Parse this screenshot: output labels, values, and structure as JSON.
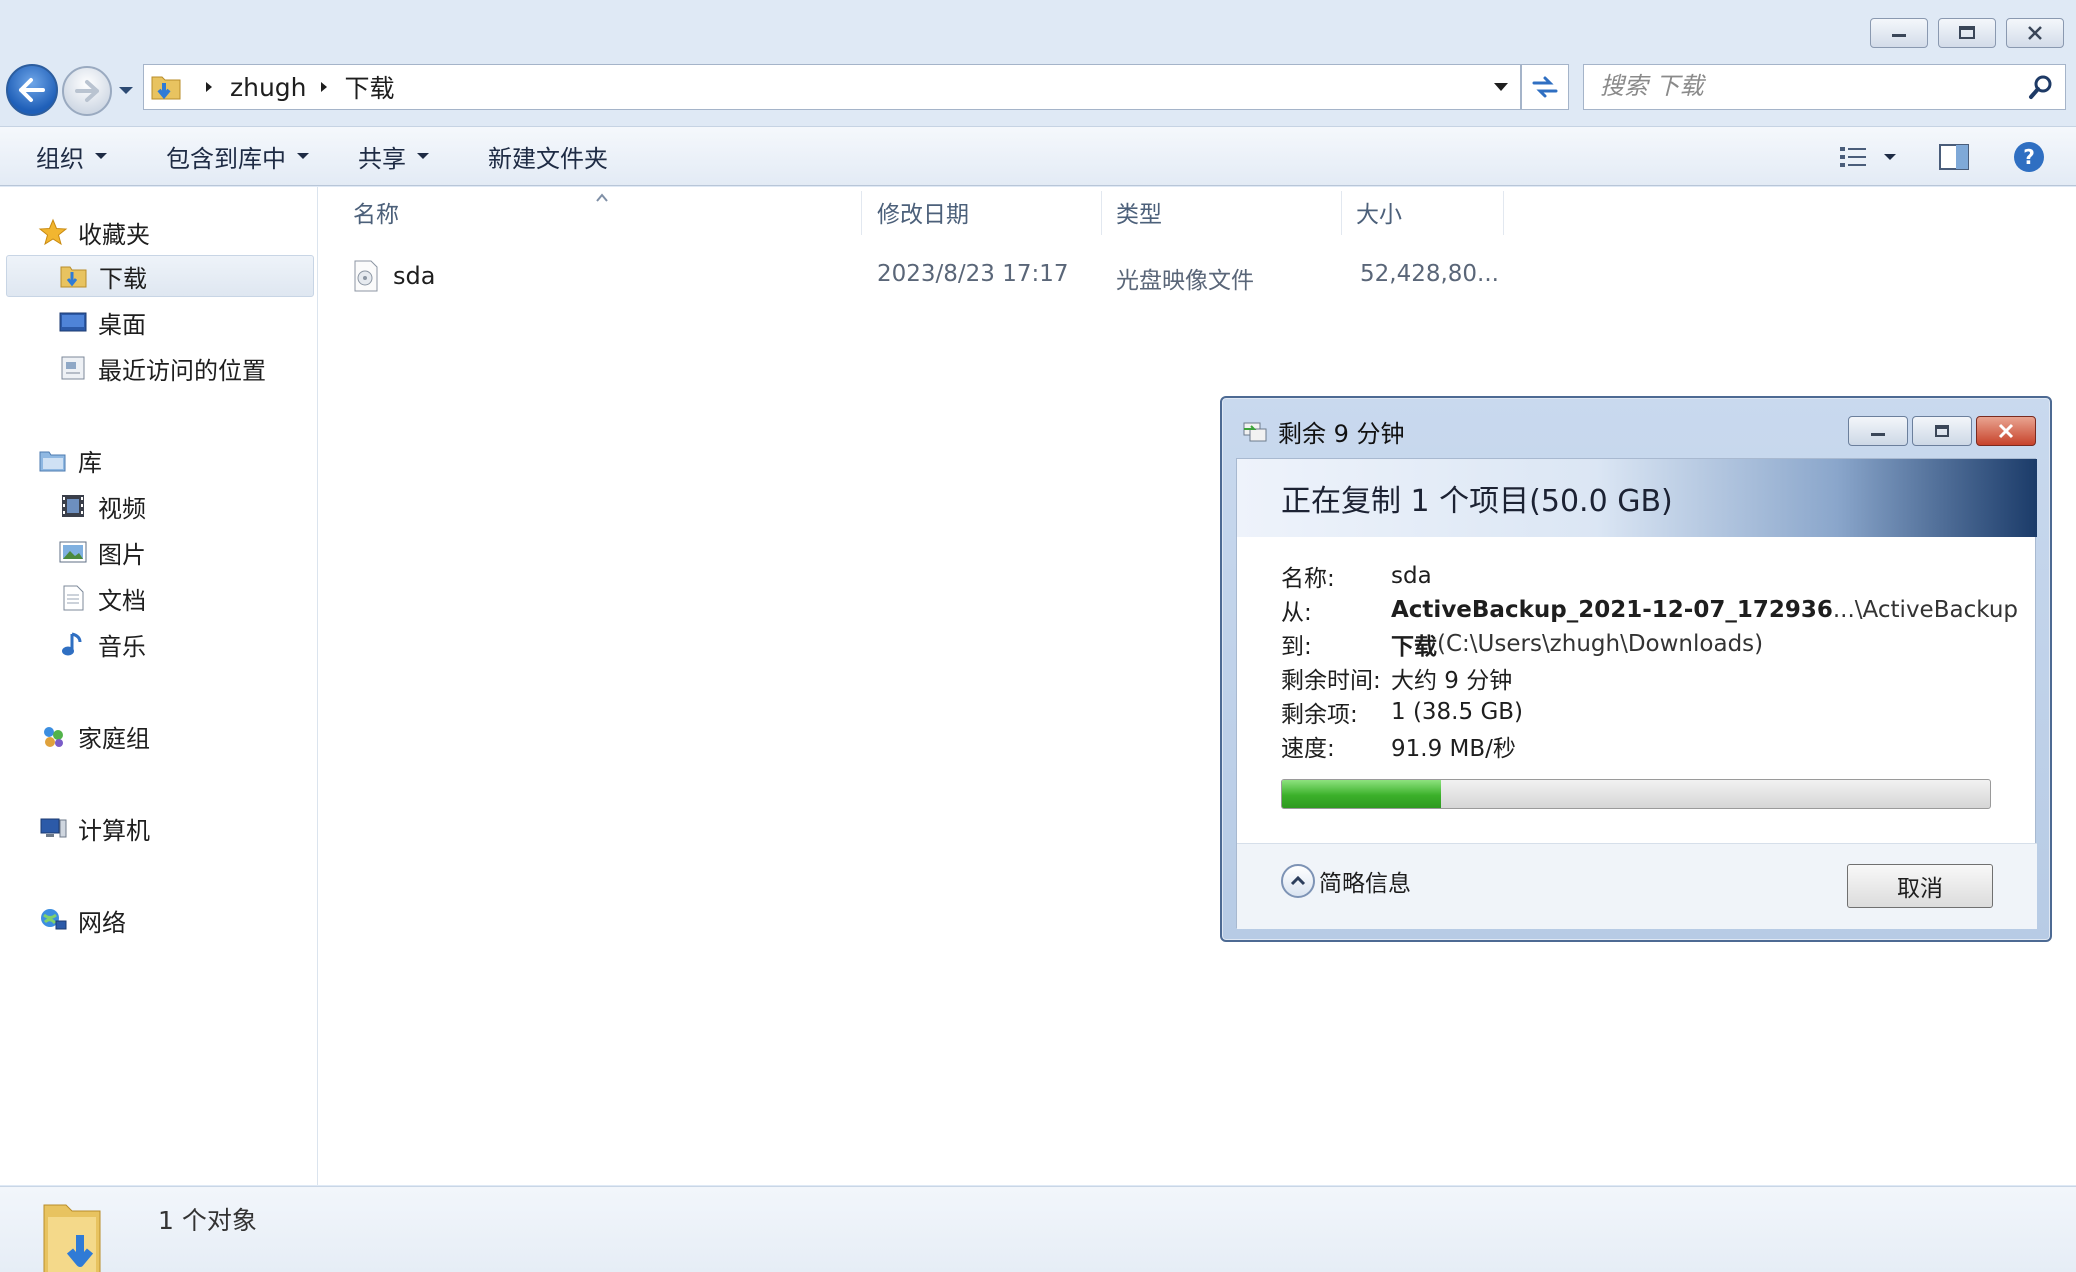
{
  "window": {
    "caption": {
      "minimize": "minimize",
      "maximize": "maximize",
      "close": "close"
    }
  },
  "address": {
    "crumbs": [
      "zhugh",
      "下载"
    ],
    "search_placeholder": "搜索 下载"
  },
  "toolbar": {
    "organize": "组织",
    "include_in_library": "包含到库中",
    "share": "共享",
    "new_folder": "新建文件夹"
  },
  "nav": {
    "favorites": "收藏夹",
    "downloads": "下载",
    "desktop": "桌面",
    "recent": "最近访问的位置",
    "libraries": "库",
    "videos": "视频",
    "pictures": "图片",
    "documents": "文档",
    "music": "音乐",
    "homegroup": "家庭组",
    "computer": "计算机",
    "network": "网络"
  },
  "columns": {
    "name": "名称",
    "modified": "修改日期",
    "type": "类型",
    "size": "大小"
  },
  "files": [
    {
      "name": "sda",
      "modified": "2023/8/23 17:17",
      "type": "光盘映像文件",
      "size": "52,428,80..."
    }
  ],
  "status": {
    "count": "1 个对象"
  },
  "dialog": {
    "title": "剩余 9 分钟",
    "heading": "正在复制 1 个项目(50.0 GB)",
    "name_label": "名称:",
    "name_value": "sda",
    "from_label": "从:",
    "from_value_bold": "ActiveBackup_2021-12-07_172936",
    "from_value_rest": " ...\\ActiveBackup",
    "to_label": "到:",
    "to_value_bold": "下载",
    "to_value_rest": " (C:\\Users\\zhugh\\Downloads)",
    "time_label": "剩余时间:",
    "time_value": "大约 9 分钟",
    "items_label": "剩余项:",
    "items_value": "1 (38.5 GB)",
    "speed_label": "速度:",
    "speed_value": "91.9 MB/秒",
    "progress": 0.225,
    "details_label": "简略信息",
    "cancel_label": "取消"
  },
  "colors": {
    "accent": "#1f5fb8",
    "progress": "#3bb02a",
    "close": "#c7432b"
  }
}
